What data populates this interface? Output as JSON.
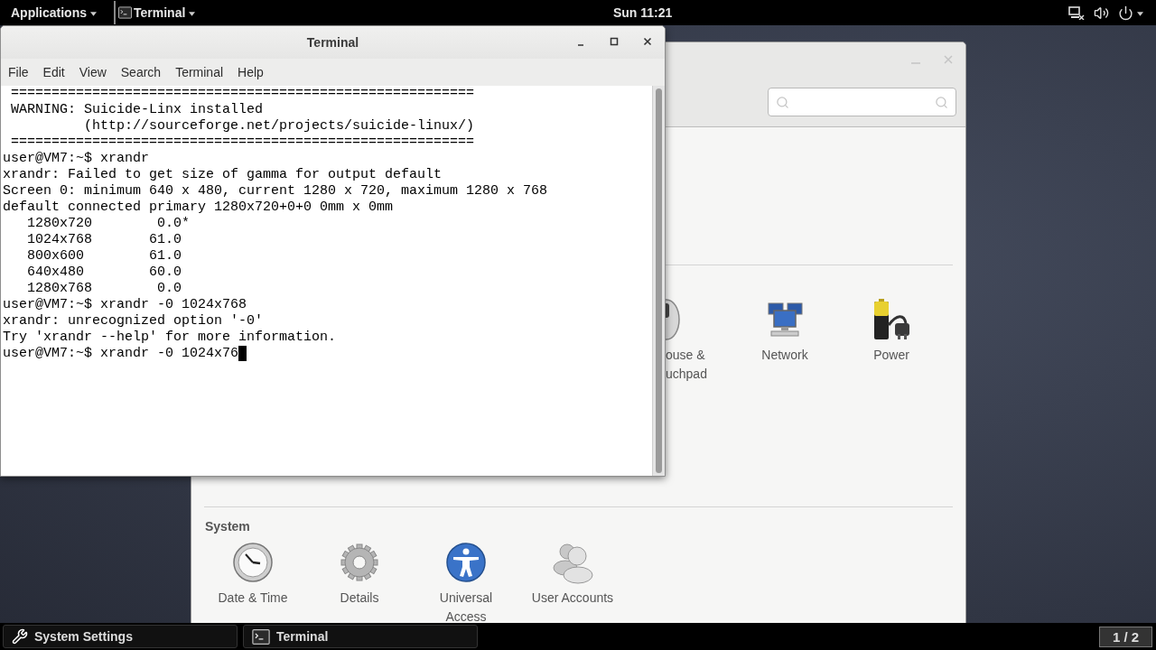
{
  "top_bar": {
    "applications": "Applications",
    "app_menu": "Terminal",
    "clock": "Sun 11:21"
  },
  "terminal": {
    "title": "Terminal",
    "menu": [
      "File",
      "Edit",
      "View",
      "Search",
      "Terminal",
      "Help"
    ],
    "lines": [
      " =========================================================",
      " WARNING: Suicide-Linx installed",
      "          (http://sourceforge.net/projects/suicide-linux/)",
      " =========================================================",
      "user@VM7:~$ xrandr",
      "xrandr: Failed to get size of gamma for output default",
      "Screen 0: minimum 640 x 480, current 1280 x 720, maximum 1280 x 768",
      "default connected primary 1280x720+0+0 0mm x 0mm",
      "   1280x720        0.0*",
      "   1024x768       61.0",
      "   800x600        61.0",
      "   640x480        60.0",
      "   1280x768        0.0",
      "user@VM7:~$ xrandr -0 1024x768",
      "xrandr: unrecognized option '-0'",
      "Try 'xrandr --help' for more information.",
      "user@VM7:~$ xrandr -0 1024x76"
    ],
    "cursor": true
  },
  "settings": {
    "sections": [
      {
        "items": [
          {
            "label": "ouse &\nuchpad",
            "kind": "mouse"
          },
          {
            "label": "Network",
            "kind": "network"
          },
          {
            "label": "Power",
            "kind": "power"
          }
        ]
      },
      {
        "heading": "System",
        "items": [
          {
            "label": "Date & Time",
            "kind": "clock"
          },
          {
            "label": "Details",
            "kind": "gear"
          },
          {
            "label": "Universal\nAccess",
            "kind": "accessibility"
          },
          {
            "label": "User Accounts",
            "kind": "users"
          }
        ]
      }
    ]
  },
  "taskbar": {
    "windows": [
      {
        "label": "System Settings",
        "kind": "tools"
      },
      {
        "label": "Terminal",
        "kind": "terminal"
      }
    ],
    "workspace": "1 / 2"
  }
}
